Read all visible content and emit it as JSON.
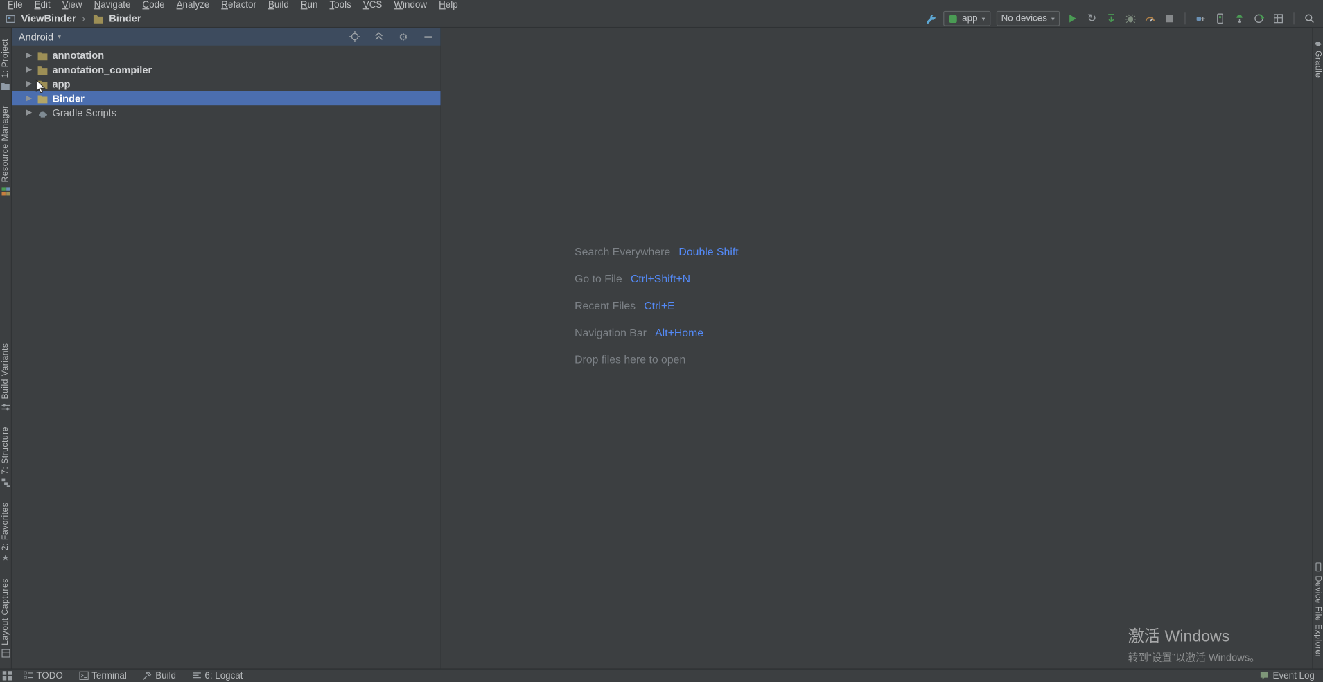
{
  "menu": {
    "items": [
      "File",
      "Edit",
      "View",
      "Navigate",
      "Code",
      "Analyze",
      "Refactor",
      "Build",
      "Run",
      "Tools",
      "VCS",
      "Window",
      "Help"
    ]
  },
  "navbar": {
    "project": "ViewBinder",
    "separator": "›",
    "module": "Binder"
  },
  "toolbar": {
    "run_config": "app",
    "device_selector": "No devices",
    "icon_names": [
      "wrench",
      "run",
      "rerun",
      "apply-changes",
      "debug",
      "profile",
      "stop",
      "attach-debugger",
      "avd-manager",
      "sdk-manager",
      "gradle-sync",
      "layout-inspector",
      "search"
    ]
  },
  "project_panel": {
    "view_selector": "Android",
    "header_icon_names": [
      "locate",
      "collapse-all",
      "settings",
      "hide"
    ],
    "tree": [
      {
        "label": "annotation",
        "type": "module",
        "selected": false
      },
      {
        "label": "annotation_compiler",
        "type": "module",
        "selected": false
      },
      {
        "label": "app",
        "type": "module",
        "selected": false
      },
      {
        "label": "Binder",
        "type": "module",
        "selected": true
      },
      {
        "label": "Gradle Scripts",
        "type": "gradle",
        "selected": false
      }
    ]
  },
  "left_stripe": {
    "buttons": [
      "1: Project",
      "Resource Manager",
      "Build Variants",
      "7: Structure",
      "2: Favorites",
      "Layout Captures"
    ]
  },
  "right_stripe": {
    "buttons": [
      "Gradle",
      "Device File Explorer"
    ]
  },
  "editor": {
    "hints": [
      {
        "label": "Search Everywhere",
        "shortcut": "Double Shift"
      },
      {
        "label": "Go to File",
        "shortcut": "Ctrl+Shift+N"
      },
      {
        "label": "Recent Files",
        "shortcut": "Ctrl+E"
      },
      {
        "label": "Navigation Bar",
        "shortcut": "Alt+Home"
      },
      {
        "label": "Drop files here to open",
        "shortcut": ""
      }
    ]
  },
  "status_bar": {
    "items": [
      "TODO",
      "Terminal",
      "Build",
      "6: Logcat"
    ],
    "right": "Event Log"
  },
  "watermark": {
    "line1": "激活 Windows",
    "line2": "转到“设置”以激活 Windows。"
  },
  "colors": {
    "selection": "#4b6eaf",
    "shortcut_blue": "#548af7",
    "run_green": "#4a9b54",
    "panel_bg": "#3c3f41"
  }
}
